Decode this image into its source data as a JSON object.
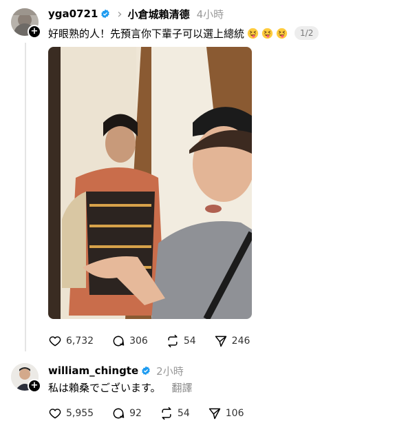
{
  "post": {
    "username": "yga0721",
    "chevron": "›",
    "reply_to": "小倉城賴清德",
    "time": "4小時",
    "text": "好眼熟的人！先預言你下輩子可以選上總統",
    "emojis": [
      "squinting-face-with-tongue",
      "squinting-face-with-tongue",
      "squinting-face-with-tongue"
    ],
    "pager": "1/2",
    "actions": {
      "likes": "6,732",
      "comments": "306",
      "reposts": "54",
      "shares": "246"
    }
  },
  "reply": {
    "username": "william_chingte",
    "time": "2小時",
    "text": "私は賴桑でございます。",
    "translate": "翻譯",
    "actions": {
      "likes": "5,955",
      "comments": "92",
      "reposts": "54",
      "shares": "106"
    }
  },
  "icons": [
    "heart-icon",
    "comment-icon",
    "repost-icon",
    "share-icon",
    "verified-badge-icon",
    "plus-icon"
  ],
  "colors": {
    "verified": "#1d9bf0",
    "muted": "#999999",
    "thread_line": "#e5e5e5"
  }
}
